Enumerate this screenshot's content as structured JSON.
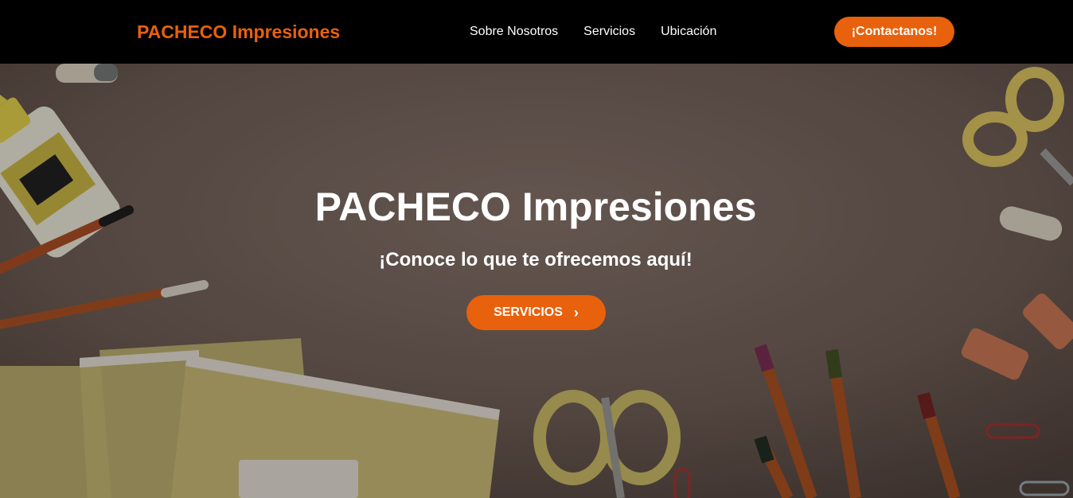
{
  "navbar": {
    "brand": "PACHECO Impresiones",
    "links": [
      "Sobre Nosotros",
      "Servicios",
      "Ubicación"
    ],
    "cta_label": "¡Contactanos!"
  },
  "hero": {
    "title": "PACHECO Impresiones",
    "subtitle": "¡Conoce lo que te ofrecemos aquí!",
    "button_label": "SERVICIOS",
    "button_icon": "chevron-right-icon",
    "background_image": "desk with stationery: glue bottle, pencils, notebooks, scissors, markers, erasers, paper clips"
  },
  "colors": {
    "accent": "#e8610c",
    "navbar_bg": "#000000",
    "hero_overlay": "#6f5f57"
  }
}
